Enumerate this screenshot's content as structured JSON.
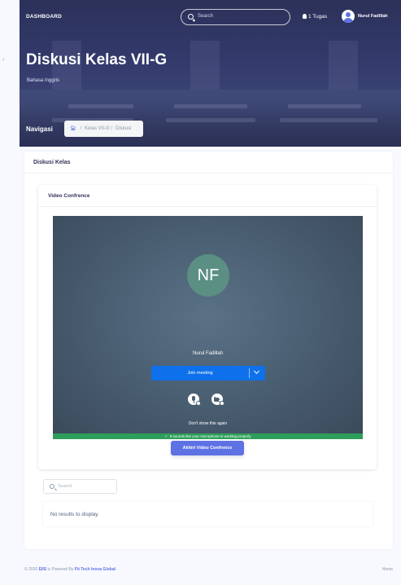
{
  "topnav": {
    "brand": "DASHBOARD",
    "search_placeholder": "Search",
    "tasks": "1 Tugas",
    "user_name": "Nurul Fadillah"
  },
  "header": {
    "title": "Diskusi Kelas VII-G",
    "subtitle": "Bahasa Inggris",
    "nav_label": "Navigasi",
    "breadcrumb": [
      "Kelas VII-G",
      "Diskusi"
    ]
  },
  "discussion_card": {
    "title": "Diskusi Kelas"
  },
  "video_card": {
    "title": "Video Confrence",
    "meeting": {
      "initials": "NF",
      "name": "Nurul Fadillah",
      "join_label": "Join meeting",
      "dont_show": "Don't show this again",
      "sound_status": "It sounds like your microphone is working properly"
    },
    "end_button": "Akhiri Video Confrence"
  },
  "list": {
    "search_placeholder": "Search",
    "empty_text": "No results to display."
  },
  "footer": {
    "copyright_prefix": "© 2020",
    "brand": "EIIS",
    "powered_by": "is Powered By",
    "company": "Fit Tech Inova Global",
    "home_link": "Home"
  },
  "colors": {
    "primary": "#5e72e4",
    "zoom_blue": "#0e71eb",
    "success_green": "#2e9e5b",
    "avatar_green": "#5b8f83"
  }
}
